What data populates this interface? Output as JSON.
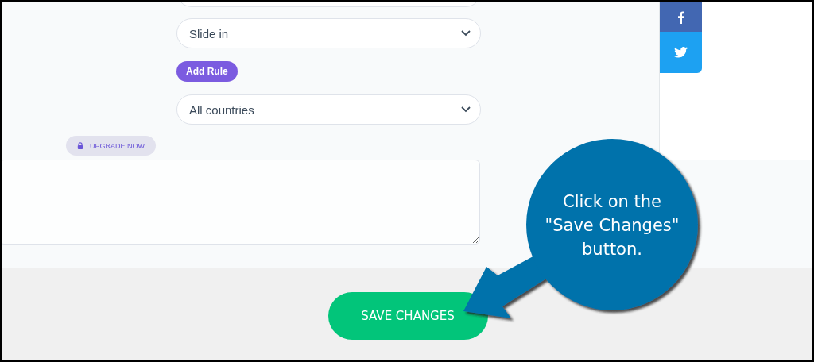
{
  "form": {
    "animation_select": {
      "value": "Slide in"
    },
    "add_rule_button": "Add Rule",
    "country_select": {
      "value": "All countries"
    },
    "upgrade_badge": "UPGRADE NOW"
  },
  "social": [
    {
      "kind": "facebook"
    },
    {
      "kind": "twitter"
    }
  ],
  "save_button": "SAVE CHANGES",
  "callout": {
    "lines": [
      "Click on the",
      "\"Save Changes\"",
      "button."
    ]
  }
}
